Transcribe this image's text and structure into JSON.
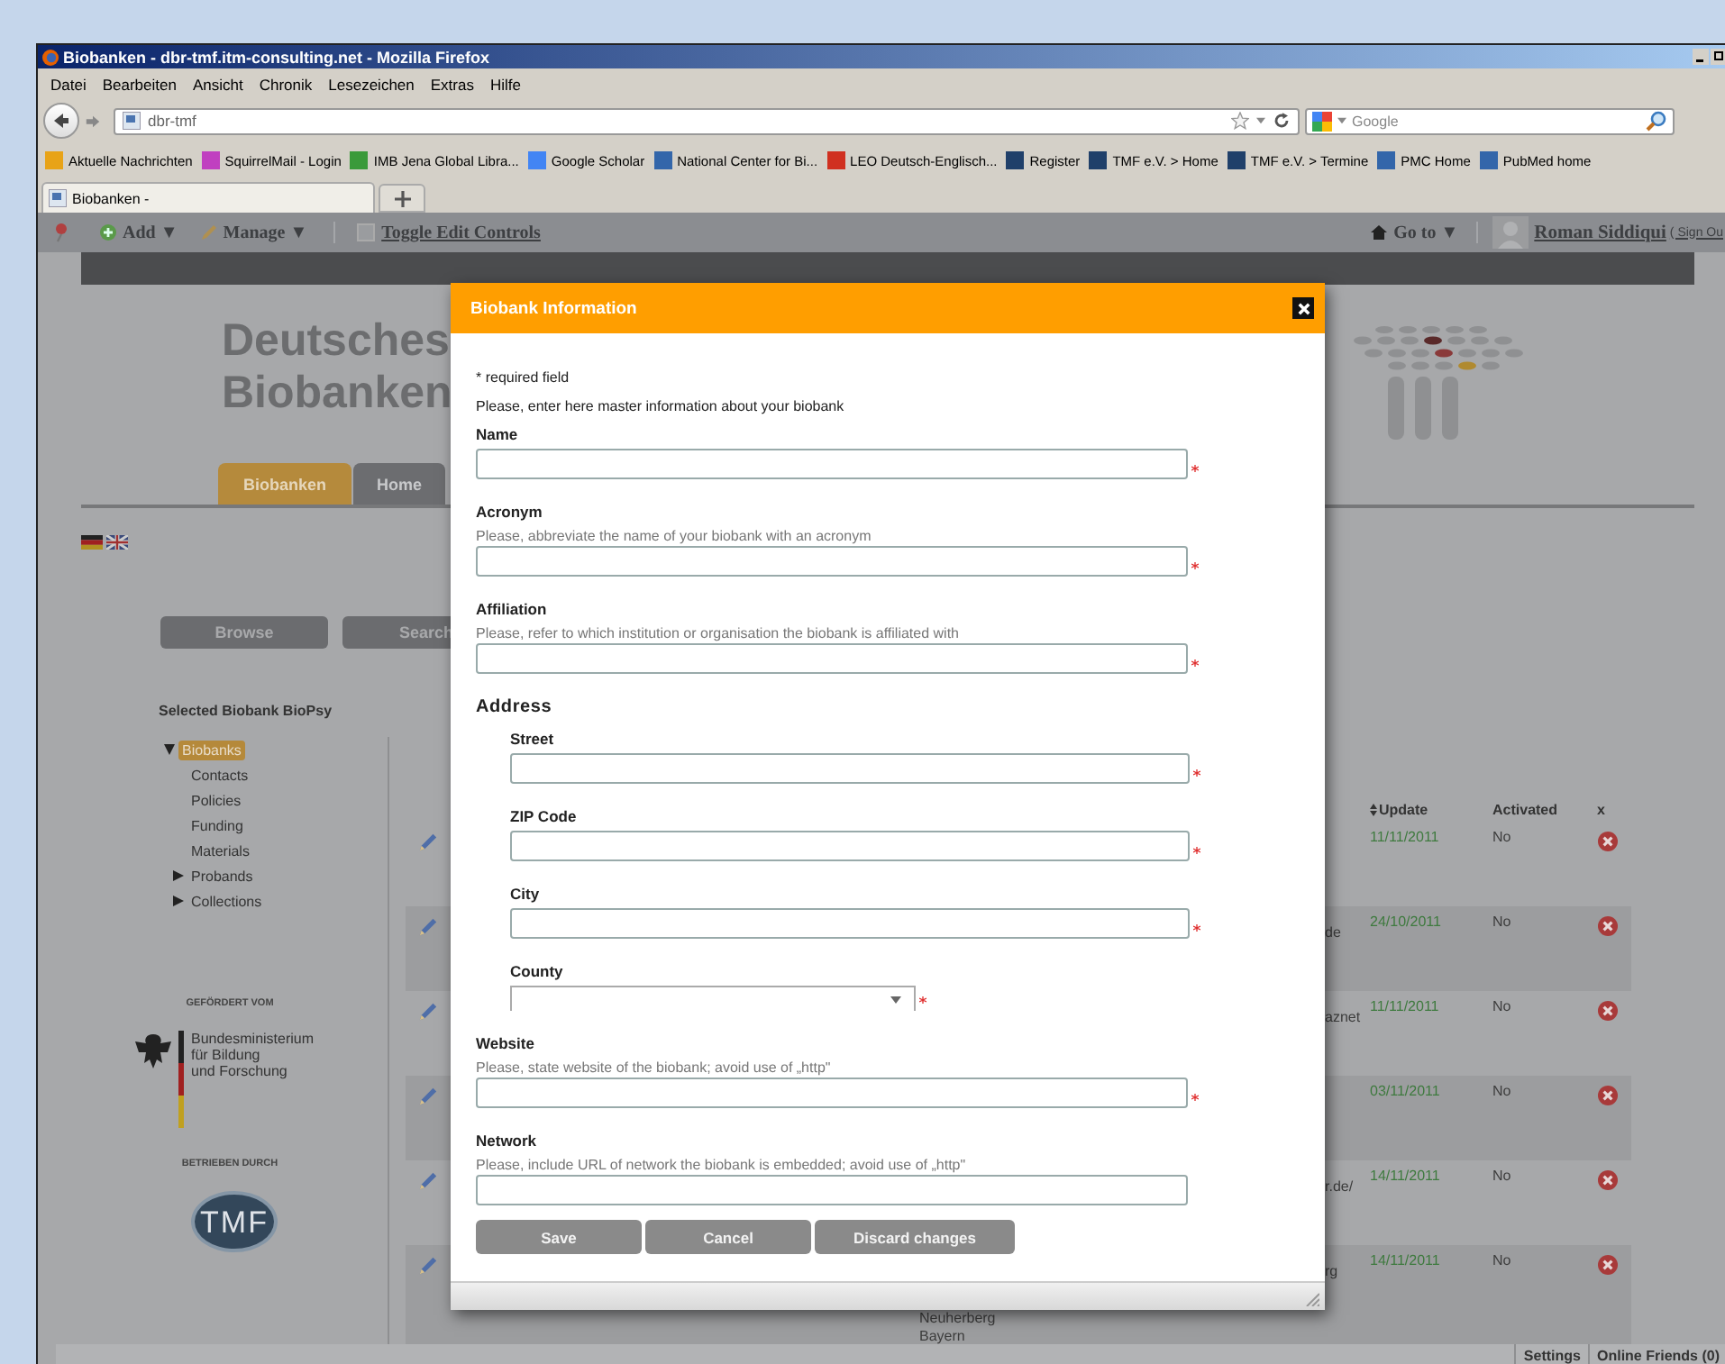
{
  "window": {
    "title": "Biobanken - dbr-tmf.itm-consulting.net - Mozilla Firefox"
  },
  "menu": [
    "Datei",
    "Bearbeiten",
    "Ansicht",
    "Chronik",
    "Lesezeichen",
    "Extras",
    "Hilfe"
  ],
  "navigation": {
    "url": "dbr-tmf",
    "search_placeholder": "Google"
  },
  "bookmarks": [
    {
      "label": "Aktuelle Nachrichten",
      "color": "#e8a317"
    },
    {
      "label": "SquirrelMail - Login",
      "color": "#c040c0"
    },
    {
      "label": "IMB Jena Global Libra...",
      "color": "#3a9a3a"
    },
    {
      "label": "Google Scholar",
      "color": "#4285f4"
    },
    {
      "label": "National Center for Bi...",
      "color": "#3366aa"
    },
    {
      "label": "LEO Deutsch-Englisch...",
      "color": "#d03020"
    },
    {
      "label": "Register",
      "color": "#20406a"
    },
    {
      "label": "TMF e.V. > Home",
      "color": "#20406a"
    },
    {
      "label": "TMF e.V. > Termine",
      "color": "#20406a"
    },
    {
      "label": "PMC Home",
      "color": "#3366aa"
    },
    {
      "label": "PubMed home",
      "color": "#3366aa"
    }
  ],
  "tabs": [
    {
      "label": "Biobanken -",
      "selected": true
    }
  ],
  "dockbar": {
    "menus": [
      "Add ▼",
      "Manage ▼"
    ],
    "toggle": {
      "label": "Toggle Edit Controls",
      "checked": false
    },
    "goto": "Go to ▼",
    "user": "Roman Siddiqui",
    "sign_out": "( Sign Ou"
  },
  "site": {
    "title_lines": [
      "Deutsches",
      "Biobanken"
    ],
    "tabs": [
      {
        "label": "Biobanken",
        "selected": true
      },
      {
        "label": "Home",
        "selected": false
      }
    ],
    "buttons": [
      "Browse",
      "Search"
    ],
    "selected_heading": "Selected Biobank BioPsy",
    "tree": [
      {
        "label": "Biobanks",
        "selected": true,
        "expanded": true,
        "children": [
          {
            "label": "Contacts",
            "selected": false
          },
          {
            "label": "Policies",
            "selected": false
          },
          {
            "label": "Funding",
            "selected": false
          },
          {
            "label": "Materials",
            "selected": false
          },
          {
            "label": "Probands",
            "selected": false,
            "expanded": false
          },
          {
            "label": "Collections",
            "selected": false,
            "expanded": false
          }
        ]
      }
    ],
    "sponsors": {
      "funded_by": "GEFÖRDERT VOM",
      "ministry": [
        "Bundesministerium",
        "für Bildung",
        "und Forschung"
      ],
      "operated_by": "BETRIEBEN DURCH",
      "operator_logo": "TMF"
    }
  },
  "table": {
    "columns": [
      "Update",
      "Activated",
      "x"
    ],
    "rows": [
      {
        "update": "11/11/2011",
        "activated": "No"
      },
      {
        "column_1": "de",
        "update": "24/10/2011",
        "activated": "No"
      },
      {
        "column_1": "aznet",
        "update": "11/11/2011",
        "activated": "No"
      },
      {
        "update": "03/11/2011",
        "activated": "No"
      },
      {
        "column_1": "r.de/",
        "update": "14/11/2011",
        "activated": "No"
      },
      {
        "column_1": "rg",
        "update": "14/11/2011",
        "activated": "No",
        "address": [
          "Neuherberg",
          "Bayern"
        ]
      }
    ]
  },
  "status_bar": [
    "Settings",
    "Online Friends (0)"
  ],
  "dialog": {
    "title": "Biobank Information",
    "required_note": "* required field",
    "intro": "Please, enter here master information about your biobank",
    "fields": [
      {
        "kind": "text",
        "label": "Name",
        "required": true
      },
      {
        "kind": "text",
        "label": "Acronym",
        "hint": "Please, abbreviate the name of your biobank with an acronym",
        "required": true
      },
      {
        "kind": "text",
        "label": "Affiliation",
        "hint": "Please, refer to which institution or organisation the biobank is affiliated with",
        "required": true
      },
      {
        "kind": "heading",
        "label": "Address"
      },
      {
        "kind": "text",
        "label": "Street",
        "indented": true,
        "required": true
      },
      {
        "kind": "text",
        "label": "ZIP Code",
        "indented": true,
        "required": true
      },
      {
        "kind": "text",
        "label": "City",
        "indented": true,
        "required": true
      },
      {
        "kind": "select",
        "label": "County",
        "indented": true,
        "required": true
      },
      {
        "kind": "text",
        "label": "Website",
        "hint": "Please, state website of the biobank; avoid use of „http\"",
        "required": true
      },
      {
        "kind": "text",
        "label": "Network",
        "hint": "Please, include URL of network the biobank is embedded; avoid use of „http\"",
        "required": false
      }
    ],
    "buttons": [
      "Save",
      "Cancel",
      "Discard changes"
    ]
  }
}
